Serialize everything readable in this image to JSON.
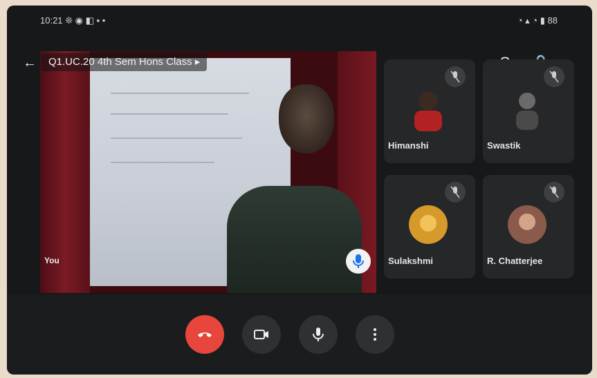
{
  "status_bar": {
    "left_text": "10:21 ❊ ◉ ◧ ▪ •",
    "right_text": "◔ ▴ ◔ ▮ 88"
  },
  "meeting": {
    "title": "Q1.UC.20 4th Sem Hons Class ▸",
    "main_speaker_name": "You"
  },
  "participants": [
    {
      "name": "Himanshi",
      "avatar_color": "#b22222",
      "muted": true
    },
    {
      "name": "Swastik",
      "avatar_color": "#5b5b5b",
      "muted": true
    },
    {
      "name": "Sulakshmi",
      "avatar_color": "#d69a2a",
      "muted": true
    },
    {
      "name": "R. Chatterjee",
      "avatar_color": "#8a5a4a",
      "muted": true
    }
  ],
  "controls": {
    "end_call": "end-call",
    "camera": "camera-toggle",
    "mic": "mic-toggle",
    "more": "more-options"
  },
  "colors": {
    "end_call": "#e8453c",
    "background": "#161819",
    "tile": "#252729"
  }
}
